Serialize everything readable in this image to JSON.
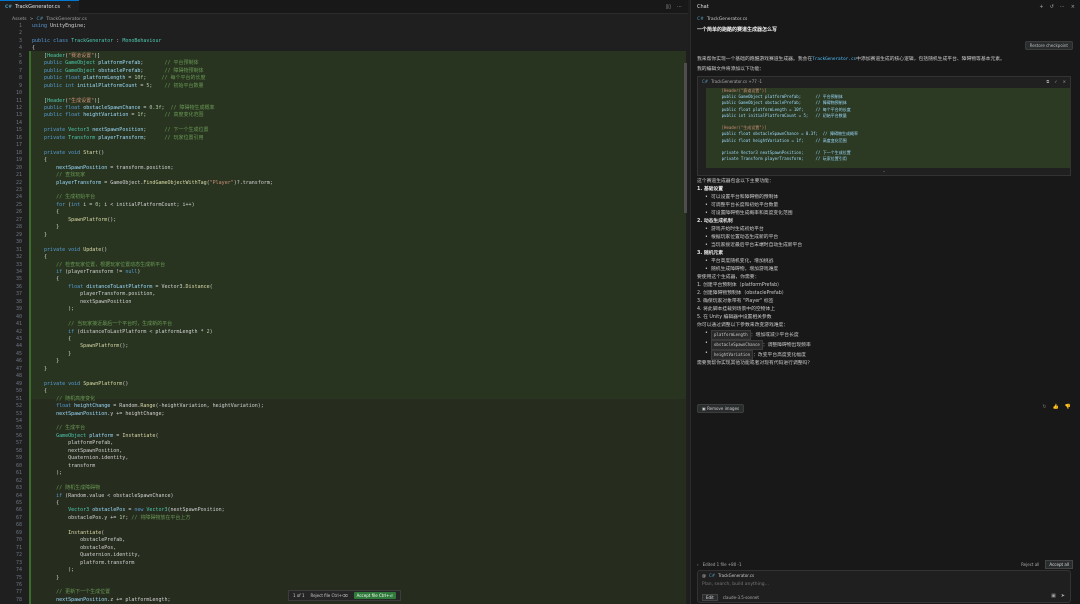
{
  "editor": {
    "tab_label": "TrackGenerator.cs",
    "breadcrumb": [
      "Assets",
      ">",
      "TrackGenerator.cs"
    ],
    "lines": [
      {
        "n": "1",
        "c": [
          [
            "kw",
            "using "
          ],
          [
            "tx",
            "UnityEngine;"
          ]
        ]
      },
      {
        "n": "2",
        "c": []
      },
      {
        "n": "3",
        "c": [
          [
            "kw",
            "public class "
          ],
          [
            "ty",
            "TrackGenerator"
          ],
          [
            "tx",
            " : "
          ],
          [
            "ty",
            "MonoBehaviour"
          ]
        ]
      },
      {
        "n": "4",
        "c": [
          [
            "tx",
            "{"
          ]
        ]
      },
      {
        "n": "5",
        "c": [
          [
            "tx",
            "    ["
          ],
          [
            "ty",
            "Header"
          ],
          [
            "tx",
            "("
          ],
          [
            "st",
            "\"赛道设置\""
          ],
          [
            "tx",
            ")]"
          ]
        ]
      },
      {
        "n": "6",
        "c": [
          [
            "kw",
            "    public "
          ],
          [
            "ty",
            "GameObject "
          ],
          [
            "va",
            "platformPrefab"
          ],
          [
            "tx",
            ";       "
          ],
          [
            "cm",
            "// 平台预制体"
          ]
        ]
      },
      {
        "n": "7",
        "c": [
          [
            "kw",
            "    public "
          ],
          [
            "ty",
            "GameObject "
          ],
          [
            "va",
            "obstaclePrefab"
          ],
          [
            "tx",
            ";       "
          ],
          [
            "cm",
            "// 障碍物预制体"
          ]
        ]
      },
      {
        "n": "8",
        "c": [
          [
            "kw",
            "    public float "
          ],
          [
            "va",
            "platformLength"
          ],
          [
            "tx",
            " = "
          ],
          [
            "nu",
            "10f"
          ],
          [
            "tx",
            ";     "
          ],
          [
            "cm",
            "// 每个平台的长度"
          ]
        ]
      },
      {
        "n": "9",
        "c": [
          [
            "kw",
            "    public int "
          ],
          [
            "va",
            "initialPlatformCount"
          ],
          [
            "tx",
            " = "
          ],
          [
            "nu",
            "5"
          ],
          [
            "tx",
            ";    "
          ],
          [
            "cm",
            "// 初始平台数量"
          ]
        ]
      },
      {
        "n": "10",
        "c": []
      },
      {
        "n": "11",
        "c": [
          [
            "tx",
            "    ["
          ],
          [
            "ty",
            "Header"
          ],
          [
            "tx",
            "("
          ],
          [
            "st",
            "\"生成设置\""
          ],
          [
            "tx",
            ")]"
          ]
        ]
      },
      {
        "n": "12",
        "c": [
          [
            "kw",
            "    public float "
          ],
          [
            "va",
            "obstacleSpawnChance"
          ],
          [
            "tx",
            " = "
          ],
          [
            "nu",
            "0.3f"
          ],
          [
            "tx",
            ";  "
          ],
          [
            "cm",
            "// 障碍物生成概率"
          ]
        ]
      },
      {
        "n": "13",
        "c": [
          [
            "kw",
            "    public float "
          ],
          [
            "va",
            "heightVariation"
          ],
          [
            "tx",
            " = "
          ],
          [
            "nu",
            "1f"
          ],
          [
            "tx",
            ";      "
          ],
          [
            "cm",
            "// 高度变化范围"
          ]
        ]
      },
      {
        "n": "14",
        "c": []
      },
      {
        "n": "15",
        "c": [
          [
            "kw",
            "    private "
          ],
          [
            "ty",
            "Vector3 "
          ],
          [
            "va",
            "nextSpawnPosition"
          ],
          [
            "tx",
            ";      "
          ],
          [
            "cm",
            "// 下一个生成位置"
          ]
        ]
      },
      {
        "n": "16",
        "c": [
          [
            "kw",
            "    private "
          ],
          [
            "ty",
            "Transform "
          ],
          [
            "va",
            "playerTransform"
          ],
          [
            "tx",
            ";      "
          ],
          [
            "cm",
            "// 玩家位置引用"
          ]
        ]
      },
      {
        "n": "17",
        "c": []
      },
      {
        "n": "18",
        "c": [
          [
            "kw",
            "    private void "
          ],
          [
            "fn",
            "Start"
          ],
          [
            "tx",
            "()"
          ]
        ]
      },
      {
        "n": "19",
        "c": [
          [
            "tx",
            "    {"
          ]
        ]
      },
      {
        "n": "20",
        "c": [
          [
            "va",
            "        nextSpawnPosition"
          ],
          [
            "tx",
            " = transform.position;"
          ]
        ]
      },
      {
        "n": "21",
        "c": [
          [
            "cm",
            "        // 查找玩家"
          ]
        ]
      },
      {
        "n": "22",
        "c": [
          [
            "va",
            "        playerTransform"
          ],
          [
            "tx",
            " = GameObject."
          ],
          [
            "fn",
            "FindGameObjectWithTag"
          ],
          [
            "tx",
            "("
          ],
          [
            "st",
            "\"Player\""
          ],
          [
            "tx",
            ")?.transform;"
          ]
        ]
      },
      {
        "n": "23",
        "c": []
      },
      {
        "n": "24",
        "c": [
          [
            "cm",
            "        // 生成初始平台"
          ]
        ]
      },
      {
        "n": "25",
        "c": [
          [
            "kw",
            "        for "
          ],
          [
            "tx",
            "("
          ],
          [
            "kw",
            "int "
          ],
          [
            "tx",
            "i = "
          ],
          [
            "nu",
            "0"
          ],
          [
            "tx",
            "; i < initialPlatformCount; i++)"
          ]
        ]
      },
      {
        "n": "26",
        "c": [
          [
            "tx",
            "        {"
          ]
        ]
      },
      {
        "n": "27",
        "c": [
          [
            "fn",
            "            SpawnPlatform"
          ],
          [
            "tx",
            "();"
          ]
        ]
      },
      {
        "n": "28",
        "c": [
          [
            "tx",
            "        }"
          ]
        ]
      },
      {
        "n": "29",
        "c": [
          [
            "tx",
            "    }"
          ]
        ]
      },
      {
        "n": "30",
        "c": []
      },
      {
        "n": "31",
        "c": [
          [
            "kw",
            "    private void "
          ],
          [
            "fn",
            "Update"
          ],
          [
            "tx",
            "()"
          ]
        ]
      },
      {
        "n": "32",
        "c": [
          [
            "tx",
            "    {"
          ]
        ]
      },
      {
        "n": "33",
        "c": [
          [
            "cm",
            "        // 检查玩家位置，根据玩家位置动态生成新平台"
          ]
        ]
      },
      {
        "n": "34",
        "c": [
          [
            "kw",
            "        if "
          ],
          [
            "tx",
            "(playerTransform != "
          ],
          [
            "kw",
            "null"
          ],
          [
            "tx",
            ")"
          ]
        ]
      },
      {
        "n": "35",
        "c": [
          [
            "tx",
            "        {"
          ]
        ]
      },
      {
        "n": "36",
        "c": [
          [
            "kw",
            "            float "
          ],
          [
            "va",
            "distanceToLastPlatform"
          ],
          [
            "tx",
            " = Vector3."
          ],
          [
            "fn",
            "Distance"
          ],
          [
            "tx",
            "("
          ]
        ]
      },
      {
        "n": "37",
        "c": [
          [
            "tx",
            "                playerTransform.position,"
          ]
        ]
      },
      {
        "n": "38",
        "c": [
          [
            "tx",
            "                nextSpawnPosition"
          ]
        ]
      },
      {
        "n": "39",
        "c": [
          [
            "tx",
            "            );"
          ]
        ]
      },
      {
        "n": "40",
        "c": []
      },
      {
        "n": "41",
        "c": [
          [
            "cm",
            "            // 当玩家接近最后一个平台时，生成新的平台"
          ]
        ]
      },
      {
        "n": "42",
        "c": [
          [
            "kw",
            "            if "
          ],
          [
            "tx",
            "(distanceToLastPlatform < platformLength * "
          ],
          [
            "nu",
            "2"
          ],
          [
            "tx",
            ")"
          ]
        ]
      },
      {
        "n": "43",
        "c": [
          [
            "tx",
            "            {"
          ]
        ]
      },
      {
        "n": "44",
        "c": [
          [
            "fn",
            "                SpawnPlatform"
          ],
          [
            "tx",
            "();"
          ]
        ]
      },
      {
        "n": "45",
        "c": [
          [
            "tx",
            "            }"
          ]
        ]
      },
      {
        "n": "46",
        "c": [
          [
            "tx",
            "        }"
          ]
        ]
      },
      {
        "n": "47",
        "c": [
          [
            "tx",
            "    }"
          ]
        ]
      },
      {
        "n": "48",
        "c": []
      },
      {
        "n": "49",
        "c": [
          [
            "kw",
            "    private void "
          ],
          [
            "fn",
            "SpawnPlatform"
          ],
          [
            "tx",
            "()"
          ]
        ]
      },
      {
        "n": "50",
        "c": [
          [
            "tx",
            "    {"
          ]
        ]
      },
      {
        "n": "51",
        "c": [
          [
            "cm",
            "        // 随机高度变化"
          ]
        ]
      },
      {
        "n": "52",
        "c": [
          [
            "kw",
            "        float "
          ],
          [
            "va",
            "heightChange"
          ],
          [
            "tx",
            " = Random."
          ],
          [
            "fn",
            "Range"
          ],
          [
            "tx",
            "(-heightVariation, heightVariation);"
          ]
        ]
      },
      {
        "n": "53",
        "c": [
          [
            "va",
            "        nextSpawnPosition"
          ],
          [
            "tx",
            ".y += heightChange;"
          ]
        ]
      },
      {
        "n": "54",
        "c": []
      },
      {
        "n": "55",
        "c": [
          [
            "cm",
            "        // 生成平台"
          ]
        ]
      },
      {
        "n": "56",
        "c": [
          [
            "ty",
            "        GameObject "
          ],
          [
            "va",
            "platform"
          ],
          [
            "tx",
            " = "
          ],
          [
            "fn",
            "Instantiate"
          ],
          [
            "tx",
            "("
          ]
        ]
      },
      {
        "n": "57",
        "c": [
          [
            "tx",
            "            platformPrefab,"
          ]
        ]
      },
      {
        "n": "58",
        "c": [
          [
            "tx",
            "            nextSpawnPosition,"
          ]
        ]
      },
      {
        "n": "59",
        "c": [
          [
            "tx",
            "            Quaternion.identity,"
          ]
        ]
      },
      {
        "n": "60",
        "c": [
          [
            "tx",
            "            transform"
          ]
        ]
      },
      {
        "n": "61",
        "c": [
          [
            "tx",
            "        );"
          ]
        ]
      },
      {
        "n": "62",
        "c": []
      },
      {
        "n": "63",
        "c": [
          [
            "cm",
            "        // 随机生成障碍物"
          ]
        ]
      },
      {
        "n": "64",
        "c": [
          [
            "kw",
            "        if "
          ],
          [
            "tx",
            "(Random.value < obstacleSpawnChance)"
          ]
        ]
      },
      {
        "n": "65",
        "c": [
          [
            "tx",
            "        {"
          ]
        ]
      },
      {
        "n": "66",
        "c": [
          [
            "ty",
            "            Vector3 "
          ],
          [
            "va",
            "obstaclePos"
          ],
          [
            "tx",
            " = "
          ],
          [
            "kw",
            "new "
          ],
          [
            "ty",
            "Vector3"
          ],
          [
            "tx",
            "(nextSpawnPosition;"
          ]
        ]
      },
      {
        "n": "67",
        "c": [
          [
            "tx",
            "            obstaclePos.y += "
          ],
          [
            "nu",
            "1f"
          ],
          [
            "tx",
            "; "
          ],
          [
            "cm",
            "// 将障碍物放在平台上方"
          ]
        ]
      },
      {
        "n": "68",
        "c": []
      },
      {
        "n": "69",
        "c": [
          [
            "fn",
            "            Instantiate"
          ],
          [
            "tx",
            "("
          ]
        ]
      },
      {
        "n": "70",
        "c": [
          [
            "tx",
            "                obstaclePrefab,"
          ]
        ]
      },
      {
        "n": "71",
        "c": [
          [
            "tx",
            "                obstaclePos,"
          ]
        ]
      },
      {
        "n": "72",
        "c": [
          [
            "tx",
            "                Quaternion.identity,"
          ]
        ]
      },
      {
        "n": "73",
        "c": [
          [
            "tx",
            "                platform.transform"
          ]
        ]
      },
      {
        "n": "74",
        "c": [
          [
            "tx",
            "            );"
          ]
        ]
      },
      {
        "n": "75",
        "c": [
          [
            "tx",
            "        }"
          ]
        ]
      },
      {
        "n": "76",
        "c": []
      },
      {
        "n": "77",
        "c": [
          [
            "cm",
            "        // 更新下一个生成位置"
          ]
        ]
      },
      {
        "n": "78",
        "c": [
          [
            "va",
            "        nextSpawnPosition"
          ],
          [
            "tx",
            ".z += platformLength;"
          ]
        ]
      },
      {
        "n": "79",
        "c": [
          [
            "tx",
            "    }"
          ]
        ]
      }
    ],
    "diff_bar": {
      "counter": "1 of 1",
      "reject": "Reject file",
      "reject_key": "Ctrl+⌫",
      "accept": "Accept file",
      "accept_key": "Ctrl+⏎"
    }
  },
  "chat": {
    "title": "Chat",
    "context_file": "TrackGenerator.cs",
    "user_question": "一个简单的跑酷的赛道生成器怎么写",
    "restore_label": "Restore checkpoint",
    "intro": "我来帮你实现一个基础的跑酷游戏赛道生成器。我会在",
    "intro_code": "TrackGenerator.cs",
    "intro_rest": "中添加赛道生成的核心逻辑，包括随机生成平台、障碍物等基本元素。",
    "intro2": "我的编辑文件将添加以下功能：",
    "code_header": "TrackGenerator.cs +77 -1",
    "code_lines": [
      "    [Header(\"赛道设置\")]",
      "    public GameObject platformPrefab;      // 平台预制体",
      "    public GameObject obstaclePrefab;      // 障碍物预制体",
      "    public float platformLength = 10f;     // 每个平台的长度",
      "    public int initialPlatformCount = 5;   // 初始平台数量",
      "",
      "    [Header(\"生成设置\")]",
      "    public float obstacleSpawnChance = 0.3f;  // 障碍物生成概率",
      "    public float heightVariation = 1f;     // 高度变化范围",
      "",
      "    private Vector3 nextSpawnPosition;     // 下一个生成位置",
      "    private Transform playerTransform;     // 玩家位置引用"
    ],
    "summary_intro": "这个赛道生成器包含以下主要功能：",
    "sections": [
      {
        "title": "1. 基础设置",
        "items": [
          "可以设置平台和障碍物的预制体",
          "可调整平台长度和初始平台数量",
          "可设置障碍物生成概率和高度变化范围"
        ]
      },
      {
        "title": "2. 动态生成机制",
        "items": [
          "游戏开始时生成初始平台",
          "根据玩家位置动态生成新的平台",
          "当玩家接近最后平台末端时自动生成新平台"
        ]
      },
      {
        "title": "3. 随机元素",
        "items": [
          "平台高度随机变化，增加挑战",
          "随机生成障碍物，增加游戏难度"
        ]
      }
    ],
    "usage_intro": "要使用这个生成器，你需要：",
    "usage_steps": [
      "1. 创建平台预制体（platformPrefab）",
      "2. 创建障碍物预制体（obstaclePrefab）",
      "3. 确保玩家对象带有 \"Player\" 标签",
      "4. 将此脚本挂载到场景中的空物体上",
      "5. 在 Unity 编辑器中设置相关参数"
    ],
    "tweak_intro": "你可以通过调整以下参数来改变游戏难度：",
    "tweaks": [
      {
        "code": "platformLength",
        "text": "：增加或减少平台长度"
      },
      {
        "code": "obstacleSpawnChance",
        "text": "：调整障碍物出现频率"
      },
      {
        "code": "heightVariation",
        "text": "：改变平台高度变化幅度"
      }
    ],
    "closing": "需要我帮你实现其他功能或者对现有代码进行调整吗？",
    "remove_images": "Remove images",
    "edited_label": "Edited 1 file  +80 -1",
    "reject_all": "Reject all",
    "accept_all": "Accept all",
    "input_chip": "TrackGenerator.cs",
    "input_placeholder": "Plan, search, build anything...",
    "mode_label": "Edit",
    "model_label": "claude-3.5-sonnet"
  }
}
